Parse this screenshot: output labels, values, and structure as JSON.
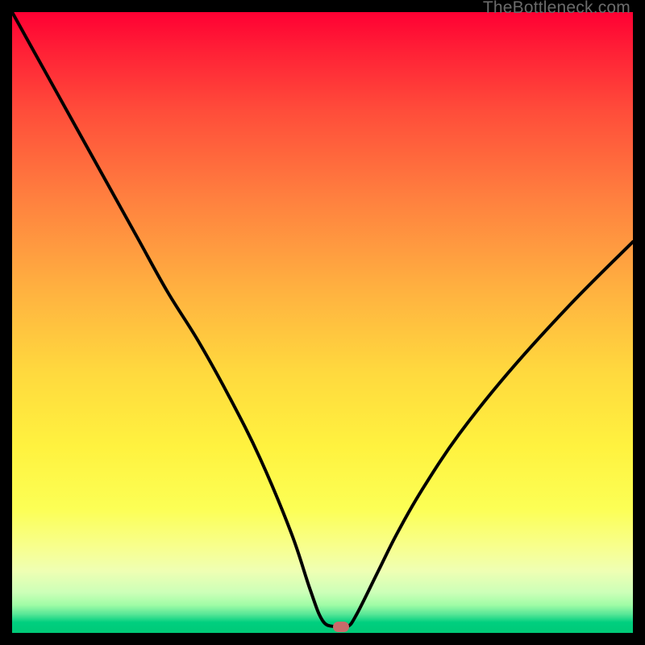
{
  "watermark": "TheBottleneck.com",
  "chart_data": {
    "type": "line",
    "title": "",
    "xlabel": "",
    "ylabel": "",
    "xlim": [
      0,
      100
    ],
    "ylim": [
      0,
      100
    ],
    "grid": false,
    "legend": false,
    "series": [
      {
        "name": "bottleneck-curve",
        "x": [
          0,
          5,
          10,
          15,
          20,
          25,
          30,
          35,
          40,
          45,
          48,
          50,
          52,
          54,
          55.5,
          59,
          62,
          66,
          72,
          80,
          90,
          100
        ],
        "values": [
          100,
          91,
          82,
          73,
          64,
          55,
          47,
          38,
          28,
          16,
          7,
          2,
          1,
          1,
          3,
          10,
          16,
          23,
          32,
          42,
          53,
          63
        ]
      }
    ],
    "marker": {
      "x": 53,
      "y": 1
    },
    "background_gradient": {
      "stops": [
        {
          "pos": 0,
          "color": "#ff0033"
        },
        {
          "pos": 0.5,
          "color": "#ffc93f"
        },
        {
          "pos": 0.8,
          "color": "#fcff55"
        },
        {
          "pos": 0.95,
          "color": "#a0fca6"
        },
        {
          "pos": 1.0,
          "color": "#00c977"
        }
      ]
    }
  }
}
